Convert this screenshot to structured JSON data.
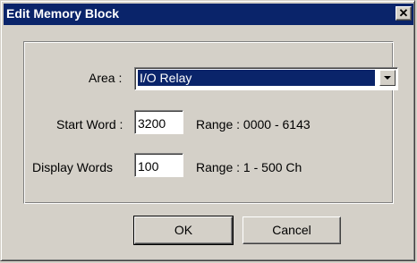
{
  "window": {
    "title": "Edit Memory Block",
    "close_glyph": "✕"
  },
  "form": {
    "area_label": "Area :",
    "area_value": "I/O Relay",
    "start_word_label": "Start Word :",
    "start_word_value": "3200",
    "start_word_range": "Range : 0000 - 6143",
    "display_words_label": "Display Words",
    "display_words_value": "100",
    "display_words_range": "Range : 1 - 500 Ch"
  },
  "buttons": {
    "ok_label": "OK",
    "cancel_label": "Cancel"
  },
  "colors": {
    "titlebar": "#0a246a",
    "face": "#d4d0c8",
    "selection": "#0a246a"
  }
}
